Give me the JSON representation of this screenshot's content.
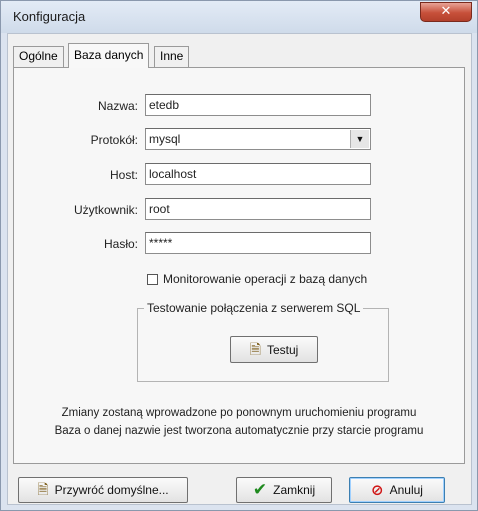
{
  "window": {
    "title": "Konfiguracja",
    "close_symbol": "✕"
  },
  "tabs": [
    {
      "label": "Ogólne",
      "active": false
    },
    {
      "label": "Baza danych",
      "active": true
    },
    {
      "label": "Inne",
      "active": false
    }
  ],
  "form": {
    "name_label": "Nazwa:",
    "name_value": "etedb",
    "protocol_label": "Protokół:",
    "protocol_value": "mysql",
    "host_label": "Host:",
    "host_value": "localhost",
    "user_label": "Użytkownik:",
    "user_value": "root",
    "password_label": "Hasło:",
    "password_value": "*****"
  },
  "monitor_checkbox": {
    "label": "Monitorowanie operacji z bazą danych",
    "checked": false
  },
  "test_group": {
    "legend": "Testowanie połączenia z serwerem SQL",
    "test_button_label": "Testuj"
  },
  "info": {
    "line1": "Zmiany zostaną wprowadzone po ponownym uruchomieniu programu",
    "line2": "Baza o danej nazwie jest tworzona automatycznie przy starcie programu"
  },
  "buttons": {
    "defaults_label": "Przywróć domyślne...",
    "close_label": "Zamknij",
    "cancel_label": "Anuluj"
  },
  "icons": {
    "doc": "doc-icon",
    "check": "check-icon",
    "cancel": "cancel-icon"
  },
  "colors": {
    "title_bar": "#cfdbea",
    "close_button": "#c7503a",
    "dialog_bg": "#f0f0f0"
  }
}
